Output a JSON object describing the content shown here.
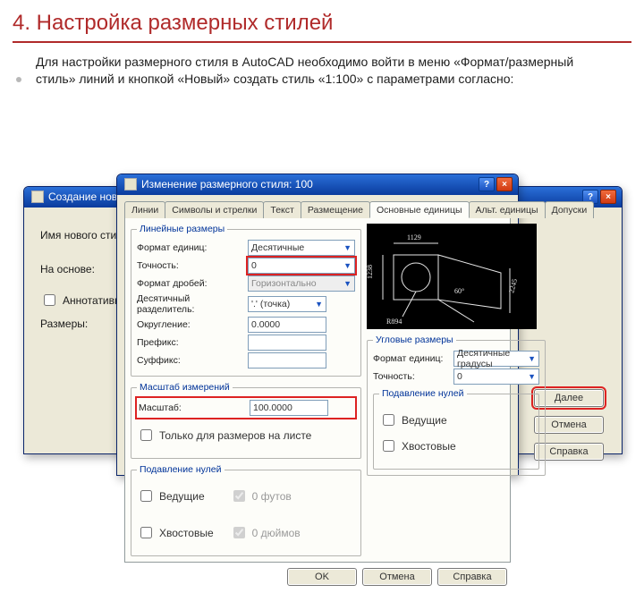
{
  "slide": {
    "title": "4. Настройка размерных стилей",
    "text": "Для настройки размерного стиля в AutoCAD необходимо войти в меню «Формат/размерный стиль» линий и кнопкой «Новый» создать стиль «1:100» с параметрами согласно:"
  },
  "back_dialog": {
    "title": "Создание ново",
    "labels": {
      "new_name": "Имя нового стиля:",
      "based_on": "На основе:",
      "annotative": "Аннотативный",
      "dims": "Размеры:"
    },
    "buttons": {
      "next": "Далее",
      "cancel": "Отмена",
      "help": "Справка"
    }
  },
  "front_dialog": {
    "title": "Изменение размерного стиля: 100",
    "tabs": {
      "lines": "Линии",
      "symbols": "Символы и стрелки",
      "text": "Текст",
      "fit": "Размещение",
      "primary": "Основные единицы",
      "alt": "Альт. единицы",
      "tol": "Допуски"
    },
    "groups": {
      "linear": "Линейные размеры",
      "scale_group": "Масштаб измерений",
      "zero": "Подавление нулей",
      "angular": "Угловые размеры",
      "zero2": "Подавление нулей"
    },
    "linear": {
      "unit_format_lbl": "Формат единиц:",
      "unit_format_val": "Десятичные",
      "precision_lbl": "Точность:",
      "precision_val": "0",
      "frac_lbl": "Формат дробей:",
      "frac_val": "Горизонтально",
      "sep_lbl": "Десятичный разделитель:",
      "sep_val": "'.' (точка)",
      "round_lbl": "Округление:",
      "round_val": "0.0000",
      "prefix_lbl": "Префикс:",
      "prefix_val": "",
      "suffix_lbl": "Суффикс:",
      "suffix_val": ""
    },
    "scale": {
      "scale_lbl": "Масштаб:",
      "scale_val": "100.0000",
      "paper_only": "Только для размеров на листе"
    },
    "zero": {
      "leading": "Ведущие",
      "trailing": "Хвостовые",
      "feet": "0 футов",
      "inches": "0 дюймов"
    },
    "angular": {
      "format_lbl": "Формат единиц:",
      "format_val": "Десятичные градусы",
      "prec_lbl": "Точность:",
      "prec_val": "0"
    },
    "zero2": {
      "leading": "Ведущие",
      "trailing": "Хвостовые"
    },
    "buttons": {
      "ok": "OK",
      "cancel": "Отмена",
      "help": "Справка"
    },
    "preview": {
      "d1": "1129",
      "d2": "1238",
      "d3": "2245",
      "ang": "60°",
      "r": "R894"
    }
  }
}
